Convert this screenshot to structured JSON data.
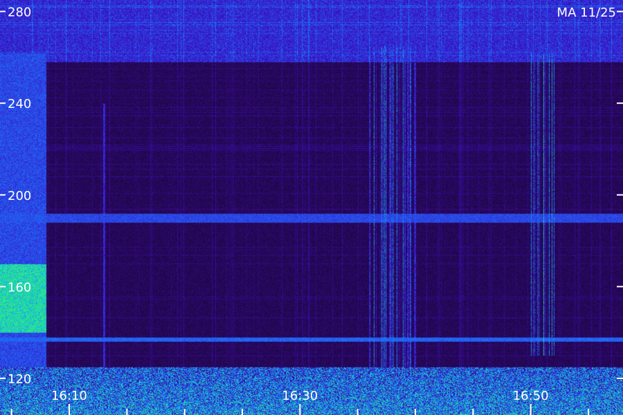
{
  "chart_data": {
    "type": "heatmap",
    "title": "",
    "stamp": "MA 11/25",
    "xlabel": "",
    "ylabel": "",
    "colormap": [
      "#050210",
      "#2a0860",
      "#3a12c8",
      "#1a7cff",
      "#18d8c0",
      "#40f060"
    ],
    "x_axis": {
      "unit": "time",
      "range": [
        "16:04",
        "16:58"
      ],
      "labeled_ticks": [
        "16:10",
        "16:30",
        "16:50"
      ],
      "minor_tick_interval_min": 5
    },
    "y_axis": {
      "range": [
        104,
        285
      ],
      "ticks": [
        120,
        160,
        200,
        240,
        280
      ]
    },
    "features": [
      {
        "name": "broadband burst",
        "time": "16:04-16:08",
        "freq_range": [
          125,
          262
        ],
        "peak_freq_range": [
          140,
          170
        ],
        "intensity": 0.95
      },
      {
        "name": "low-frequency noise band",
        "time": "16:04-16:58",
        "freq_range": [
          104,
          125
        ],
        "intensity": 0.75
      },
      {
        "name": "vertical streak",
        "time": "16:13",
        "freq_range": [
          125,
          240
        ],
        "intensity": 0.8
      },
      {
        "name": "vertical streak cluster",
        "time": "16:36-16:40",
        "freq_range": [
          125,
          265
        ],
        "intensity": 0.7
      },
      {
        "name": "vertical streak cluster",
        "time": "16:50-16:52",
        "freq_range": [
          130,
          262
        ],
        "intensity": 0.9
      },
      {
        "name": "horizontal band",
        "time": "16:04-16:58",
        "freq_range": [
          188,
          192
        ],
        "intensity": 0.45
      },
      {
        "name": "horizontal band",
        "time": "16:04-16:58",
        "freq_range": [
          136,
          138
        ],
        "intensity": 0.5
      }
    ]
  }
}
